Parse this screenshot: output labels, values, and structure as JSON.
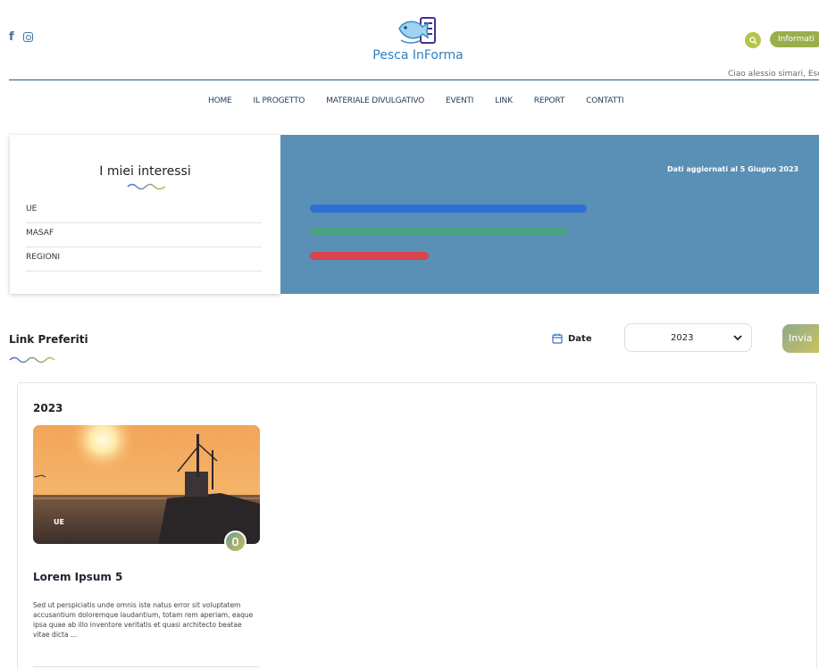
{
  "header": {
    "site_name": "Pesca InForma",
    "info_button": "Informati",
    "greeting": "Ciao alessio simari, Esci",
    "social": [
      "facebook-icon",
      "instagram-icon"
    ]
  },
  "nav": {
    "items": [
      "HOME",
      "IL PROGETTO",
      "MATERIALE DIVULGATIVO",
      "EVENTI",
      "LINK",
      "REPORT",
      "CONTATTI"
    ]
  },
  "interests": {
    "title": "I miei interessi",
    "items": [
      "UE",
      "MASAF",
      "REGIONI"
    ]
  },
  "stats": {
    "updated": "Dati aggiornati al 5 Giugno 2023",
    "bars": [
      {
        "color": "#2e6fd6",
        "fraction": 1.0
      },
      {
        "color": "#4aa083",
        "fraction": 0.93
      },
      {
        "color": "#d9434c",
        "fraction": 0.43
      }
    ]
  },
  "links": {
    "title": "Link Preferiti",
    "date_label": "Date",
    "selected_year": "2023",
    "send_button": "Invia",
    "group_year": "2023",
    "card": {
      "tag": "UE",
      "title": "Lorem Ipsum 5",
      "text": "Sed ut perspiciatis unde omnis iste natus error sit voluptatem accusantium doloremque laudantium, totam rem aperiam, eaque ipsa quae ab illo inventore veritatis et quasi architecto beatae vitae dicta ..."
    }
  },
  "colors": {
    "panel_blue": "#5a8fb6",
    "accent_green": "#9aae4c",
    "rule": "#27567e"
  }
}
